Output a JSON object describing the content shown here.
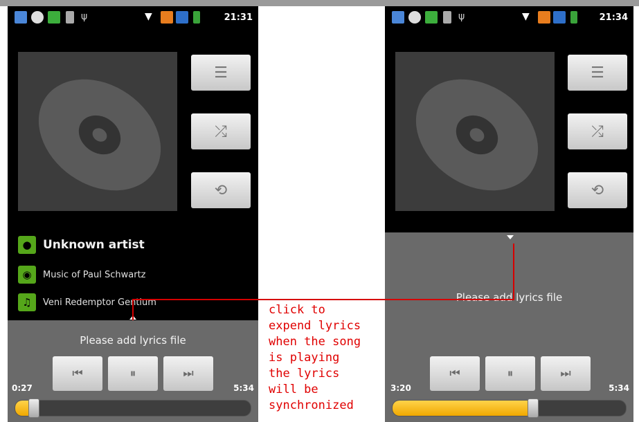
{
  "left": {
    "clock": "21:31",
    "artist": "Unknown artist",
    "album": "Music of Paul Schwartz",
    "song": "Veni Redemptor Gentium",
    "lyrics": "Please add lyrics file",
    "elapsed": "0:27",
    "duration": "5:34",
    "progress_fraction": 0.08
  },
  "right": {
    "clock": "21:34",
    "lyrics": "Please add lyrics file",
    "elapsed": "3:20",
    "duration": "5:34",
    "progress_fraction": 0.6
  },
  "annotation": [
    "click to",
    "expend lyrics",
    "when the song",
    "is playing",
    "the lyrics",
    "will be",
    "synchronized"
  ],
  "icons": {
    "playlist": "playlist-icon",
    "shuffle": "shuffle-icon",
    "repeat": "repeat-icon",
    "prev": "previous-icon",
    "pause": "pause-icon",
    "next": "next-icon"
  },
  "colors": {
    "accent": "#f0b400",
    "meta_icon": "#55a61a",
    "annotation": "#e00000"
  }
}
